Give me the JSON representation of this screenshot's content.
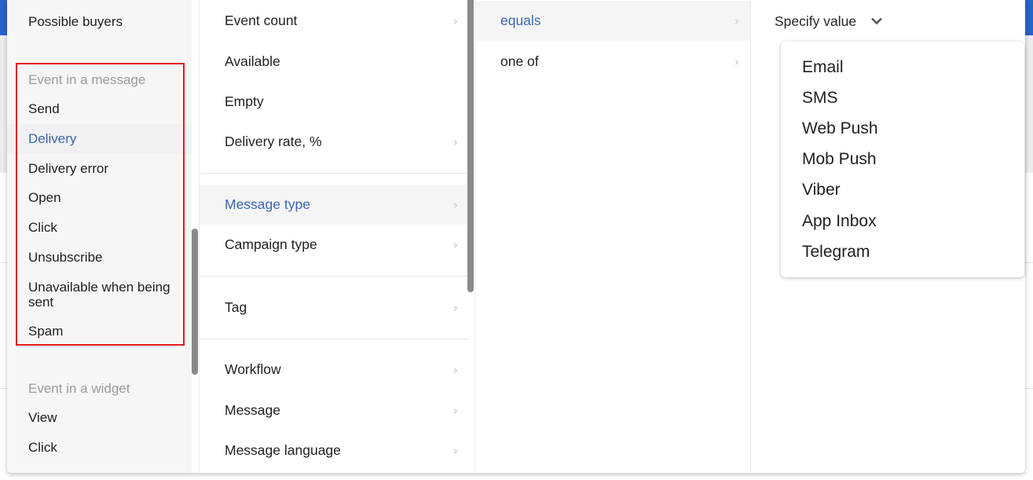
{
  "column1": {
    "items": [
      {
        "label": "Possible buyers",
        "type": "item"
      },
      {
        "label": "Event in a message",
        "type": "group"
      },
      {
        "label": "Send",
        "type": "item"
      },
      {
        "label": "Delivery",
        "type": "item",
        "active": true
      },
      {
        "label": "Delivery error",
        "type": "item"
      },
      {
        "label": "Open",
        "type": "item"
      },
      {
        "label": "Click",
        "type": "item"
      },
      {
        "label": "Unsubscribe",
        "type": "item"
      },
      {
        "label": "Unavailable when being sent",
        "type": "item"
      },
      {
        "label": "Spam",
        "type": "item"
      },
      {
        "label": "Event in a widget",
        "type": "group"
      },
      {
        "label": "View",
        "type": "item"
      },
      {
        "label": "Click",
        "type": "item"
      }
    ]
  },
  "column2": {
    "items": [
      {
        "label": "Event count",
        "has_submenu": true
      },
      {
        "label": "Available",
        "has_submenu": false
      },
      {
        "label": "Empty",
        "has_submenu": false
      },
      {
        "label": "Delivery rate, %",
        "has_submenu": true
      },
      {
        "label": "Message type",
        "has_submenu": true,
        "active": true
      },
      {
        "label": "Campaign type",
        "has_submenu": true
      },
      {
        "label": "Tag",
        "has_submenu": true
      },
      {
        "label": "Workflow",
        "has_submenu": true
      },
      {
        "label": "Message",
        "has_submenu": true
      },
      {
        "label": "Message language",
        "has_submenu": true
      }
    ]
  },
  "column3": {
    "items": [
      {
        "label": "equals",
        "has_submenu": true,
        "active": true
      },
      {
        "label": "one of",
        "has_submenu": true
      }
    ]
  },
  "column4": {
    "specify_label": "Specify value",
    "dropdown_icon": "chevron-down-icon",
    "options": [
      "Email",
      "SMS",
      "Web Push",
      "Mob Push",
      "Viber",
      "App Inbox",
      "Telegram"
    ]
  },
  "icons": {
    "submenu": "chevron-right-icon",
    "submenu_glyph": "›"
  },
  "colors": {
    "accent": "#3a67b5",
    "highlight_box": "#e01b1b",
    "header_blue": "#2a62c9"
  }
}
